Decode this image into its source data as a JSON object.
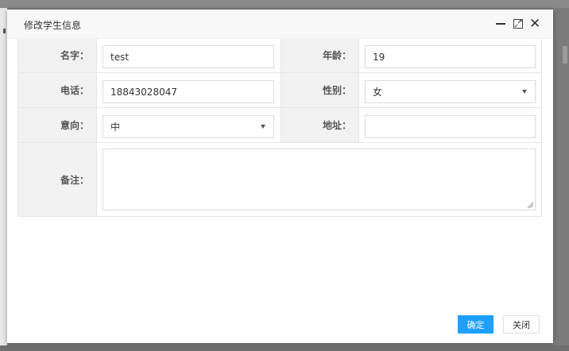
{
  "dialog": {
    "title": "修改学生信息",
    "controls": {
      "minimize_icon": "minimize-icon",
      "maximize_icon": "maximize-icon",
      "close_glyph": "✕"
    }
  },
  "form": {
    "name": {
      "label": "名字：",
      "value": "test"
    },
    "age": {
      "label": "年龄：",
      "value": "19"
    },
    "phone": {
      "label": "电话：",
      "value": "18843028047"
    },
    "gender": {
      "label": "性别：",
      "value": "女"
    },
    "intention": {
      "label": "意向：",
      "value": "中"
    },
    "address": {
      "label": "地址：",
      "value": ""
    },
    "remark": {
      "label": "备注：",
      "value": ""
    }
  },
  "buttons": {
    "confirm": "确定",
    "close": "关闭"
  },
  "colors": {
    "primary": "#1e9fff",
    "label_bg": "#f2f2f2",
    "border": "#e6e6e6"
  }
}
